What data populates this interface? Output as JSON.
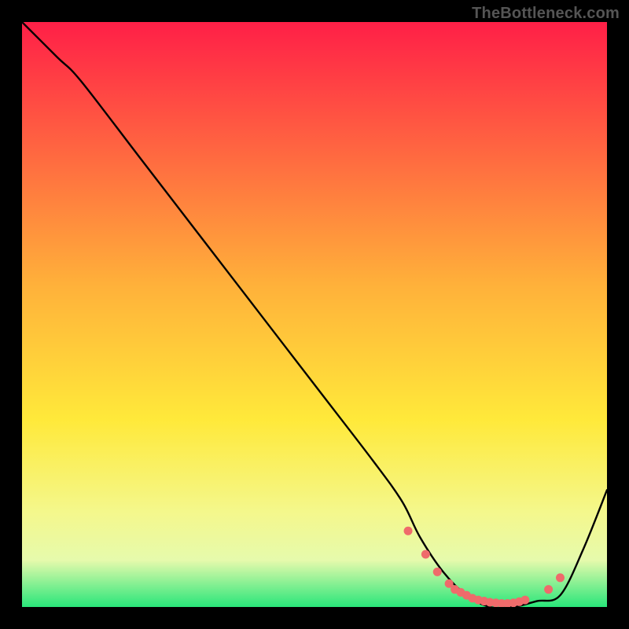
{
  "watermark": "TheBottleneck.com",
  "chart_data": {
    "type": "line",
    "title": "",
    "xlabel": "",
    "ylabel": "",
    "xlim": [
      0,
      100
    ],
    "ylim": [
      0,
      100
    ],
    "background_gradient": {
      "stops": [
        {
          "pct": 0,
          "color": "#ff1f47"
        },
        {
          "pct": 45,
          "color": "#ffb13a"
        },
        {
          "pct": 68,
          "color": "#ffe93a"
        },
        {
          "pct": 84,
          "color": "#f4f88d"
        },
        {
          "pct": 92,
          "color": "#e6faac"
        },
        {
          "pct": 100,
          "color": "#29e67a"
        }
      ]
    },
    "series": [
      {
        "name": "curve",
        "x": [
          0,
          6,
          10,
          20,
          30,
          40,
          50,
          60,
          65,
          68,
          72,
          76,
          80,
          84,
          88,
          92,
          96,
          100
        ],
        "y": [
          100,
          94,
          90,
          77,
          64,
          51,
          38,
          25,
          18,
          12,
          6,
          2,
          0,
          0,
          1,
          2,
          10,
          20
        ]
      }
    ],
    "markers": {
      "name": "dots",
      "color": "#ef6b6b",
      "x": [
        66,
        69,
        71,
        73,
        74,
        75,
        76,
        77,
        78,
        79,
        80,
        81,
        82,
        83,
        84,
        85,
        86,
        90,
        92
      ],
      "y": [
        13,
        9,
        6,
        4,
        3,
        2.5,
        2,
        1.5,
        1.2,
        1,
        0.8,
        0.7,
        0.6,
        0.6,
        0.7,
        0.9,
        1.2,
        3,
        5
      ]
    }
  }
}
